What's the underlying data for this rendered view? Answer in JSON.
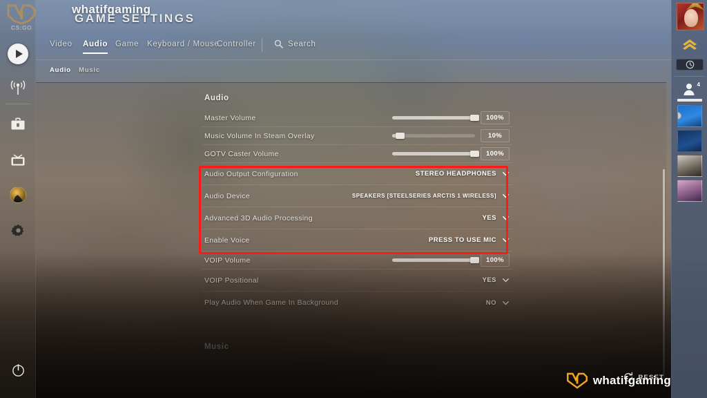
{
  "header": {
    "title": "GAME SETTINGS",
    "watermark": "whatifgaming",
    "logo_alt": "csgo-logo",
    "logo_text_cs": "CS",
    "logo_text_go": "GO"
  },
  "tabs": [
    {
      "label": "Video",
      "active": false
    },
    {
      "label": "Audio",
      "active": true
    },
    {
      "label": "Game",
      "active": false
    },
    {
      "label": "Keyboard / Mouse",
      "active": false
    },
    {
      "label": "Controller",
      "active": false
    }
  ],
  "search": {
    "label": "Search",
    "icon": "search-icon"
  },
  "subtabs": [
    {
      "label": "Audio",
      "active": true
    },
    {
      "label": "Music",
      "active": false
    }
  ],
  "left_rail": [
    {
      "icon": "play-icon",
      "name": "play-button"
    },
    {
      "icon": "broadcast-icon",
      "name": "broadcast-button"
    },
    {
      "icon": "briefcase-icon",
      "name": "inventory-button"
    },
    {
      "icon": "tv-icon",
      "name": "watch-button"
    },
    {
      "icon": "profile-avatar-icon",
      "name": "profile-button"
    },
    {
      "icon": "gear-icon",
      "name": "settings-button"
    },
    {
      "icon": "power-icon",
      "name": "power-button"
    }
  ],
  "sections": [
    {
      "title": "Audio",
      "rows": [
        {
          "type": "slider",
          "label": "Master Volume",
          "value": "100%",
          "percent": 100
        },
        {
          "type": "slider",
          "label": "Music Volume In Steam Overlay",
          "value": "10%",
          "percent": 10
        },
        {
          "type": "slider",
          "label": "GOTV Caster Volume",
          "value": "100%",
          "percent": 100
        },
        {
          "type": "dropdown",
          "label": "Audio Output Configuration",
          "value": "STEREO HEADPHONES",
          "highlighted": true
        },
        {
          "type": "dropdown",
          "label": "Audio Device",
          "value": "SPEAKERS [STEELSERIES ARCTIS 1 WIRELESS]",
          "highlighted": true
        },
        {
          "type": "dropdown",
          "label": "Advanced 3D Audio Processing",
          "value": "YES",
          "highlighted": true
        },
        {
          "type": "dropdown",
          "label": "Enable Voice",
          "value": "PRESS TO USE MIC",
          "highlighted": true
        },
        {
          "type": "slider",
          "label": "VOIP Volume",
          "value": "100%",
          "percent": 100
        },
        {
          "type": "dropdown",
          "label": "VOIP Positional",
          "value": "YES"
        },
        {
          "type": "dropdown",
          "label": "Play Audio When Game In Background",
          "value": "NO"
        }
      ]
    },
    {
      "title": "Music",
      "rows": []
    }
  ],
  "highlight": {
    "color": "#ff1a1a"
  },
  "right_rail": {
    "friends_count": "4",
    "rank_icon": "chevron-rank-icon",
    "clock_icon": "clock-icon",
    "person_icon": "person-icon"
  },
  "footer": {
    "reset_label": "RESET",
    "reset_icon": "reset-circular-arrow-icon",
    "watermark": "whatifgaming"
  },
  "colors": {
    "accent_gold": "#e8b43c",
    "highlight_red": "#ff1a1a",
    "text_primary": "#ffffff",
    "rail_blue": "#56657e"
  }
}
